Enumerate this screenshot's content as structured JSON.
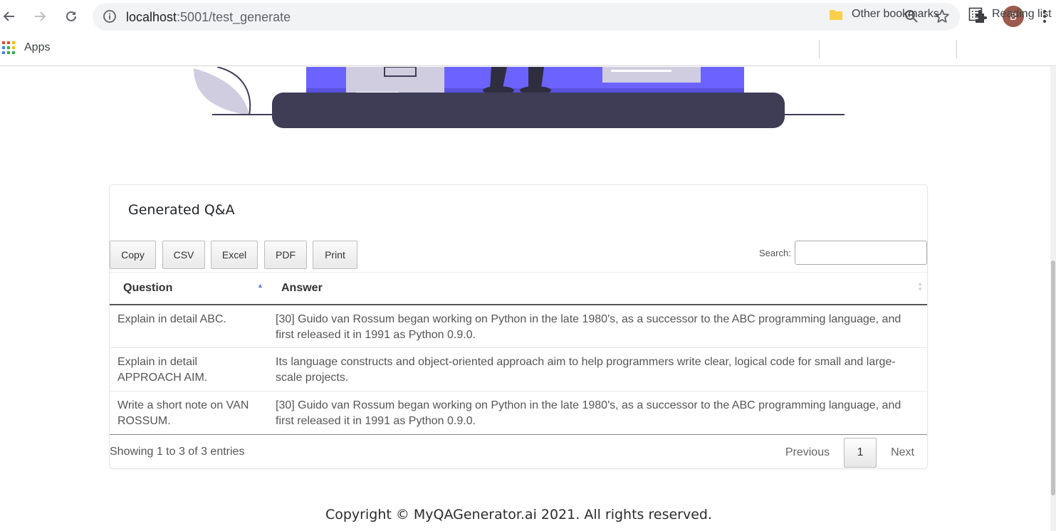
{
  "browser": {
    "url_host": "localhost",
    "url_path": ":5001/test_generate",
    "profile_initial": "B"
  },
  "bookmarks": {
    "apps_label": "Apps",
    "other_label": "Other bookmarks",
    "reading_label": "Reading list"
  },
  "card": {
    "title": "Generated Q&A",
    "buttons": [
      "Copy",
      "CSV",
      "Excel",
      "PDF",
      "Print"
    ],
    "search_label": "Search:",
    "search_value": ""
  },
  "table": {
    "columns": [
      "Question",
      "Answer"
    ],
    "rows": [
      {
        "question": "Explain in detail ABC.",
        "answer": "[30] Guido van Rossum began working on Python in the late 1980's, as a successor to the ABC programming language, and first released it in 1991 as Python 0.9.0."
      },
      {
        "question": "Explain in detail APPROACH AIM.",
        "answer": "Its language constructs and object-oriented approach aim to help programmers write clear, logical code for small and large-scale projects."
      },
      {
        "question": "Write a short note on VAN ROSSUM.",
        "answer": "[30] Guido van Rossum began working on Python in the late 1980's, as a successor to the ABC programming language, and first released it in 1991 as Python 0.9.0."
      }
    ],
    "info": "Showing 1 to 3 of 3 entries",
    "pagination": {
      "previous": "Previous",
      "current": "1",
      "next": "Next"
    }
  },
  "footer": {
    "text": "Copyright © MyQAGenerator.ai 2021. All rights reserved."
  },
  "colors": {
    "accent": "#6c63ff",
    "dark": "#3f3d56",
    "light": "#d0cde1"
  }
}
